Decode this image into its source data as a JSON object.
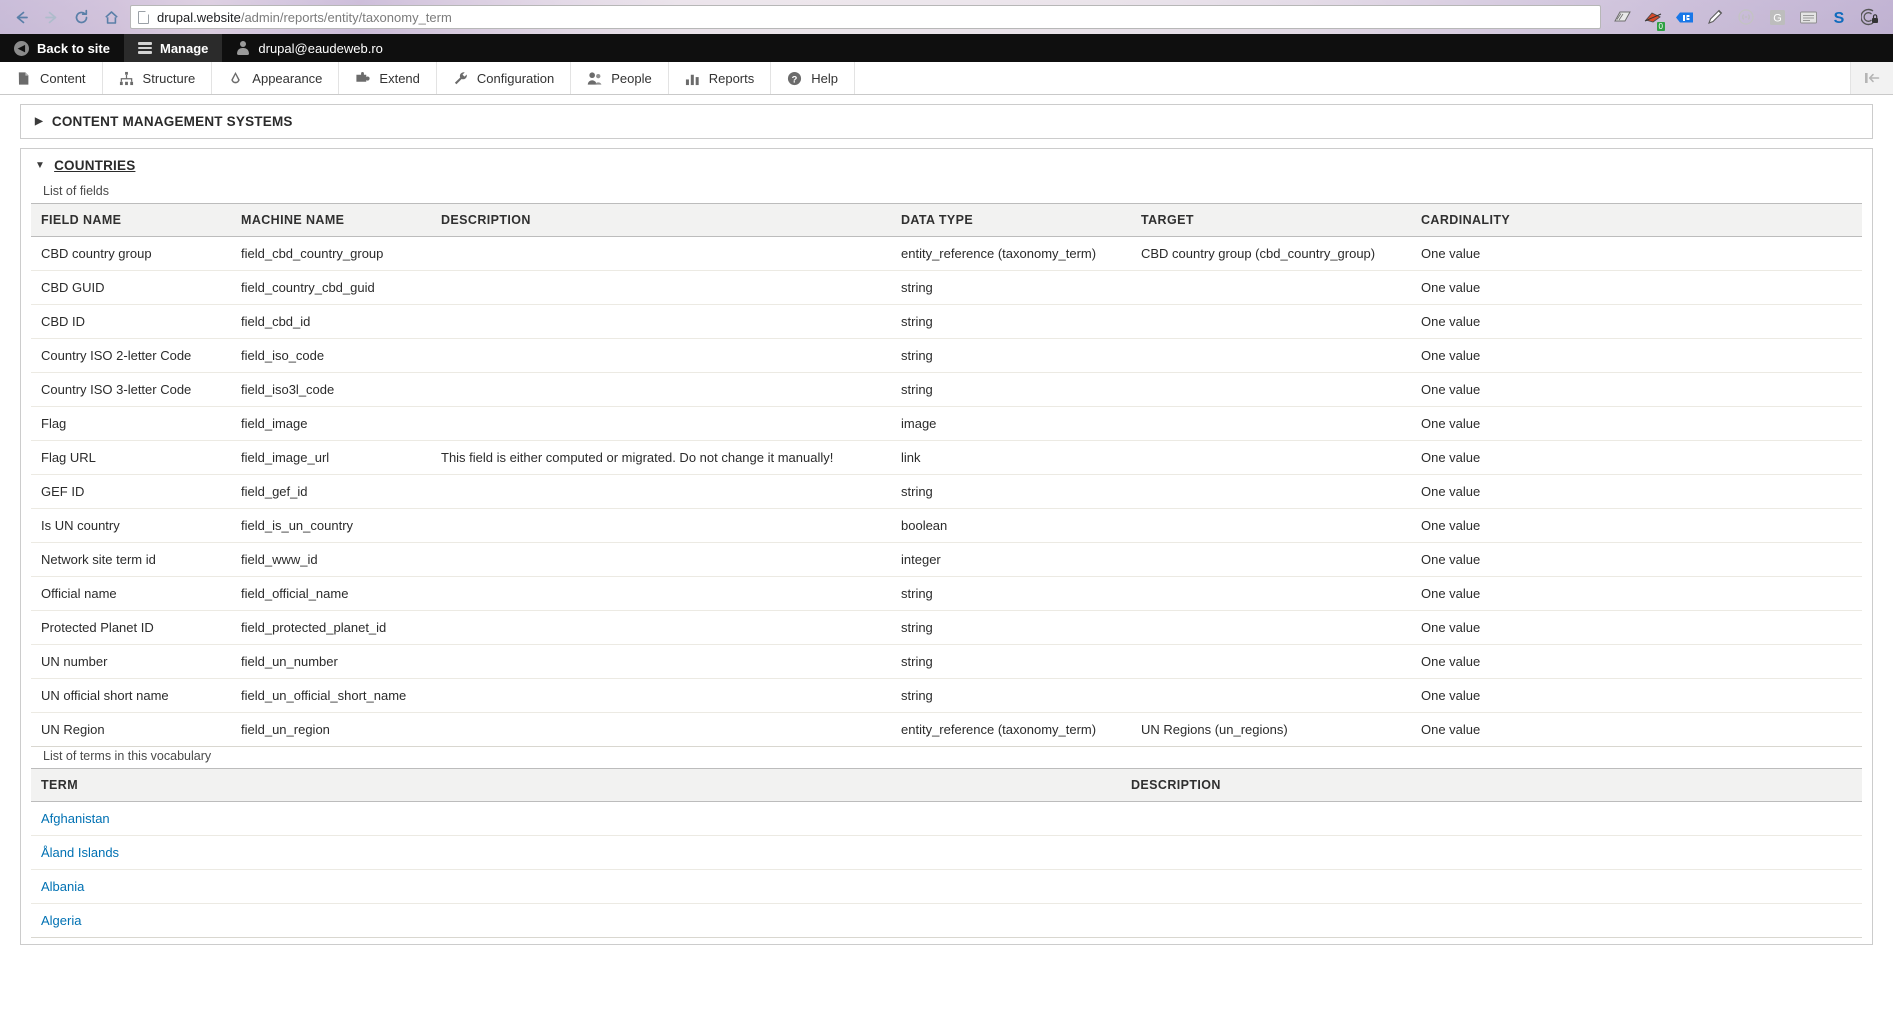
{
  "browser": {
    "back_icon": "back-arrow-icon",
    "forward_icon": "forward-arrow-icon",
    "reload_icon": "reload-icon",
    "home_icon": "home-icon",
    "url_host": "drupal.website",
    "url_path": "/admin/reports/entity/taxonomy_term",
    "url_full": "drupal.website/admin/reports/entity/taxonomy_term",
    "extensions": [
      {
        "name": "scan-document-icon",
        "glyph": "✇"
      },
      {
        "name": "bug-debug-icon",
        "glyph": "✱",
        "badge": "0"
      },
      {
        "name": "bookmark-tag-icon",
        "glyph": "☰"
      },
      {
        "name": "pencil-edit-icon",
        "glyph": "✎"
      },
      {
        "name": "parentheses-icon",
        "glyph": "(··)"
      },
      {
        "name": "grammarly-g-icon",
        "glyph": "G"
      },
      {
        "name": "note-card-icon",
        "glyph": "▤"
      },
      {
        "name": "skype-s-icon",
        "glyph": "S"
      },
      {
        "name": "vpn-lock-icon",
        "glyph": "Ⓘ"
      }
    ]
  },
  "admin_bar": {
    "back_to_site": "Back to site",
    "manage": "Manage",
    "user": "drupal@eaudeweb.ro"
  },
  "admin_menu": {
    "items": [
      {
        "label": "Content",
        "icon": "content-page-icon"
      },
      {
        "label": "Structure",
        "icon": "structure-nodes-icon"
      },
      {
        "label": "Appearance",
        "icon": "appearance-paintbrush-icon"
      },
      {
        "label": "Extend",
        "icon": "extend-puzzle-icon"
      },
      {
        "label": "Configuration",
        "icon": "configuration-wrench-icon"
      },
      {
        "label": "People",
        "icon": "people-users-icon"
      },
      {
        "label": "Reports",
        "icon": "reports-barchart-icon"
      },
      {
        "label": "Help",
        "icon": "help-question-icon"
      }
    ],
    "collapse_icon": "collapse-sidebar-icon"
  },
  "sections": [
    {
      "title": "CONTENT MANAGEMENT SYSTEMS",
      "expanded": false,
      "marker": "▶"
    }
  ],
  "countries": {
    "title": "COUNTRIES",
    "marker": "▼",
    "fields_caption": "List of fields",
    "fields_headers": [
      "FIELD NAME",
      "MACHINE NAME",
      "DESCRIPTION",
      "DATA TYPE",
      "TARGET",
      "CARDINALITY"
    ],
    "fields_rows": [
      {
        "field": "CBD country group",
        "machine": "field_cbd_country_group",
        "description": "",
        "data_type": "entity_reference (taxonomy_term)",
        "target": "CBD country group (cbd_country_group)",
        "cardinality": "One value"
      },
      {
        "field": "CBD GUID",
        "machine": "field_country_cbd_guid",
        "description": "",
        "data_type": "string",
        "target": "",
        "cardinality": "One value"
      },
      {
        "field": "CBD ID",
        "machine": "field_cbd_id",
        "description": "",
        "data_type": "string",
        "target": "",
        "cardinality": "One value"
      },
      {
        "field": "Country ISO 2-letter Code",
        "machine": "field_iso_code",
        "description": "",
        "data_type": "string",
        "target": "",
        "cardinality": "One value"
      },
      {
        "field": "Country ISO 3-letter Code",
        "machine": "field_iso3l_code",
        "description": "",
        "data_type": "string",
        "target": "",
        "cardinality": "One value"
      },
      {
        "field": "Flag",
        "machine": "field_image",
        "description": "",
        "data_type": "image",
        "target": "",
        "cardinality": "One value"
      },
      {
        "field": "Flag URL",
        "machine": "field_image_url",
        "description": "This field is either computed or migrated. Do not change it manually!",
        "data_type": "link",
        "target": "",
        "cardinality": "One value"
      },
      {
        "field": "GEF ID",
        "machine": "field_gef_id",
        "description": "",
        "data_type": "string",
        "target": "",
        "cardinality": "One value"
      },
      {
        "field": "Is UN country",
        "machine": "field_is_un_country",
        "description": "",
        "data_type": "boolean",
        "target": "",
        "cardinality": "One value"
      },
      {
        "field": "Network site term id",
        "machine": "field_www_id",
        "description": "",
        "data_type": "integer",
        "target": "",
        "cardinality": "One value"
      },
      {
        "field": "Official name",
        "machine": "field_official_name",
        "description": "",
        "data_type": "string",
        "target": "",
        "cardinality": "One value"
      },
      {
        "field": "Protected Planet ID",
        "machine": "field_protected_planet_id",
        "description": "",
        "data_type": "string",
        "target": "",
        "cardinality": "One value"
      },
      {
        "field": "UN number",
        "machine": "field_un_number",
        "description": "",
        "data_type": "string",
        "target": "",
        "cardinality": "One value"
      },
      {
        "field": "UN official short name",
        "machine": "field_un_official_short_name",
        "description": "",
        "data_type": "string",
        "target": "",
        "cardinality": "One value"
      },
      {
        "field": "UN Region",
        "machine": "field_un_region",
        "description": "",
        "data_type": "entity_reference (taxonomy_term)",
        "target": "UN Regions (un_regions)",
        "cardinality": "One value"
      }
    ],
    "terms_caption": "List of terms in this vocabulary",
    "terms_headers": [
      "TERM",
      "DESCRIPTION"
    ],
    "terms_rows": [
      {
        "term": "Afghanistan",
        "description": ""
      },
      {
        "term": "Åland Islands",
        "description": ""
      },
      {
        "term": "Albania",
        "description": ""
      },
      {
        "term": "Algeria",
        "description": ""
      }
    ]
  },
  "colors": {
    "link": "#0071b3",
    "toolbar_bg": "#0f0f0f",
    "header_bg": "#f2f2f1",
    "badge_green": "#2ea043"
  }
}
